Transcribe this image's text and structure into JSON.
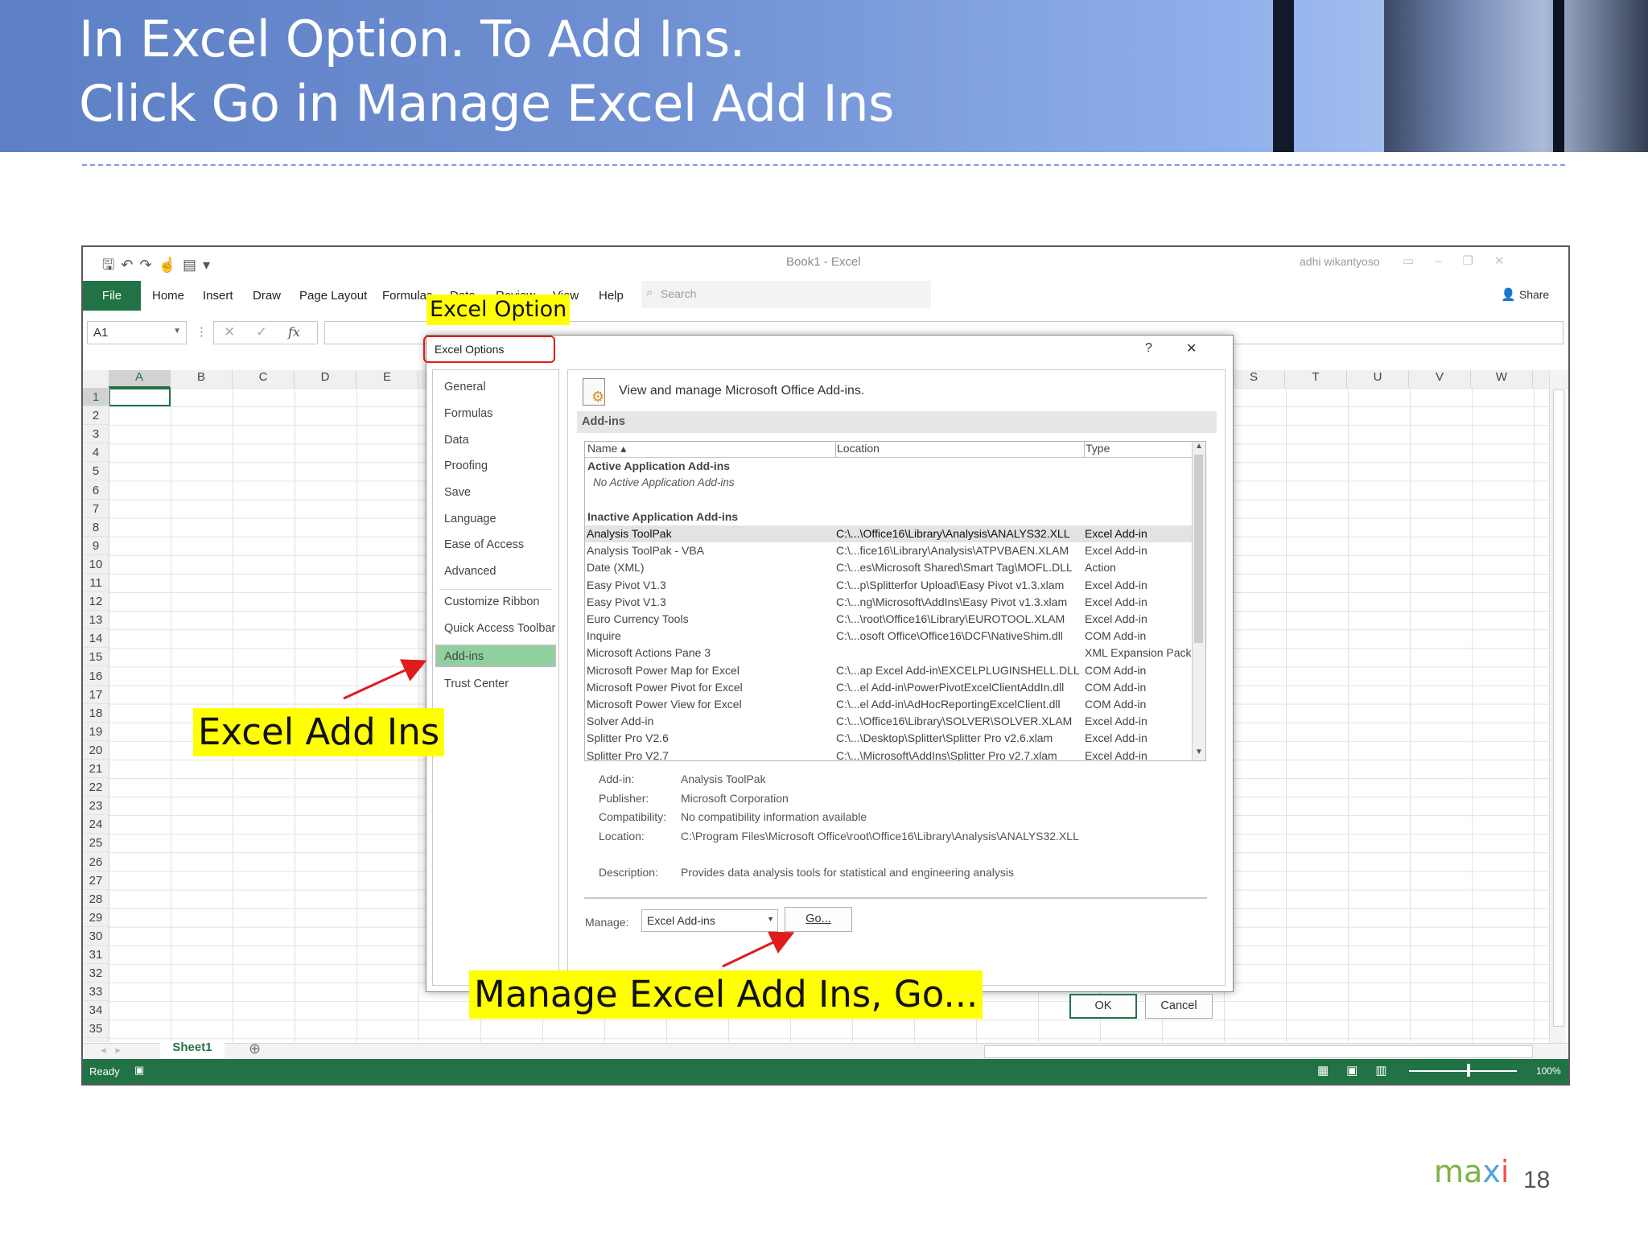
{
  "slide": {
    "title_line1": "In Excel Option. To Add Ins.",
    "title_line2": "Click Go in Manage Excel Add Ins",
    "page_number": "18",
    "logo_text": "maxi"
  },
  "excel": {
    "window_title": "Book1  -  Excel",
    "user_name": "adhi wikantyoso",
    "ribbon_tabs": [
      "File",
      "Home",
      "Insert",
      "Draw",
      "Page Layout",
      "Formulas",
      "Data",
      "Review",
      "View",
      "Help"
    ],
    "search_placeholder": "Search",
    "share_label": "Share",
    "name_box": "A1",
    "fx_label": "fx",
    "columns_left": [
      "A",
      "B",
      "C",
      "D",
      "E"
    ],
    "columns_right": [
      "S",
      "T",
      "U",
      "V",
      "W"
    ],
    "rows": [
      "1",
      "2",
      "3",
      "4",
      "5",
      "6",
      "7",
      "8",
      "9",
      "10",
      "11",
      "12",
      "13",
      "14",
      "15",
      "16",
      "17",
      "18",
      "19",
      "20",
      "21",
      "22",
      "23",
      "24",
      "25",
      "26",
      "27",
      "28",
      "29",
      "30",
      "31",
      "32",
      "33",
      "34",
      "35"
    ],
    "sheet_tab": "Sheet1",
    "status_text": "Ready",
    "zoom": "100%"
  },
  "dialog": {
    "title": "Excel Options",
    "help": "?",
    "close": "✕",
    "nav": [
      "General",
      "Formulas",
      "Data",
      "Proofing",
      "Save",
      "Language",
      "Ease of Access",
      "Advanced",
      "Customize Ribbon",
      "Quick Access Toolbar",
      "Add-ins",
      "Trust Center"
    ],
    "selected_nav": "Add-ins",
    "heading": "View and manage Microsoft Office Add-ins.",
    "section": "Add-ins",
    "col_name": "Name ▴",
    "col_location": "Location",
    "col_type": "Type",
    "active_header": "Active Application Add-ins",
    "active_empty": "No Active Application Add-ins",
    "inactive_header": "Inactive Application Add-ins",
    "addins": [
      {
        "name": "Analysis ToolPak",
        "location": "C:\\...\\Office16\\Library\\Analysis\\ANALYS32.XLL",
        "type": "Excel Add-in"
      },
      {
        "name": "Analysis ToolPak - VBA",
        "location": "C:\\...fice16\\Library\\Analysis\\ATPVBAEN.XLAM",
        "type": "Excel Add-in"
      },
      {
        "name": "Date (XML)",
        "location": "C:\\...es\\Microsoft Shared\\Smart Tag\\MOFL.DLL",
        "type": "Action"
      },
      {
        "name": "Easy Pivot  V1.3",
        "location": "C:\\...p\\Splitterfor Upload\\Easy Pivot  v1.3.xlam",
        "type": "Excel Add-in"
      },
      {
        "name": "Easy Pivot V1.3",
        "location": "C:\\...ng\\Microsoft\\AddIns\\Easy Pivot v1.3.xlam",
        "type": "Excel Add-in"
      },
      {
        "name": "Euro Currency Tools",
        "location": "C:\\...\\root\\Office16\\Library\\EUROTOOL.XLAM",
        "type": "Excel Add-in"
      },
      {
        "name": "Inquire",
        "location": "C:\\...osoft Office\\Office16\\DCF\\NativeShim.dll",
        "type": "COM Add-in"
      },
      {
        "name": "Microsoft Actions Pane 3",
        "location": "",
        "type": "XML Expansion Pack"
      },
      {
        "name": "Microsoft Power Map for Excel",
        "location": "C:\\...ap Excel Add-in\\EXCELPLUGINSHELL.DLL",
        "type": "COM Add-in"
      },
      {
        "name": "Microsoft Power Pivot for Excel",
        "location": "C:\\...el Add-in\\PowerPivotExcelClientAddIn.dll",
        "type": "COM Add-in"
      },
      {
        "name": "Microsoft Power View for Excel",
        "location": "C:\\...el Add-in\\AdHocReportingExcelClient.dll",
        "type": "COM Add-in"
      },
      {
        "name": "Solver Add-in",
        "location": "C:\\...\\Office16\\Library\\SOLVER\\SOLVER.XLAM",
        "type": "Excel Add-in"
      },
      {
        "name": "Splitter Pro  V2.6",
        "location": "C:\\...\\Desktop\\Splitter\\Splitter Pro  v2.6.xlam",
        "type": "Excel Add-in"
      },
      {
        "name": "Splitter Pro  V2.7",
        "location": "C:\\...\\Microsoft\\AddIns\\Splitter Pro  v2.7.xlam",
        "type": "Excel Add-in"
      }
    ],
    "details": [
      {
        "label": "Add-in:",
        "value": "Analysis ToolPak"
      },
      {
        "label": "Publisher:",
        "value": "Microsoft Corporation"
      },
      {
        "label": "Compatibility:",
        "value": "No compatibility information available"
      },
      {
        "label": "Location:",
        "value": "C:\\Program Files\\Microsoft Office\\root\\Office16\\Library\\Analysis\\ANALYS32.XLL"
      }
    ],
    "description_label": "Description:",
    "description_value": "Provides data analysis tools for statistical and engineering analysis",
    "manage_label": "Manage:",
    "manage_value": "Excel Add-ins",
    "go_label": "Go...",
    "ok_label": "OK",
    "cancel_label": "Cancel"
  },
  "callouts": {
    "excel_option": "Excel Option",
    "excel_add_ins": "Excel Add Ins",
    "manage_go": "Manage  Excel Add Ins, Go..."
  },
  "colors": {
    "excel_green": "#217346",
    "callout_yellow": "#ffff00",
    "highlight_red": "#e01b1b",
    "nav_selected": "#8fd19e"
  }
}
